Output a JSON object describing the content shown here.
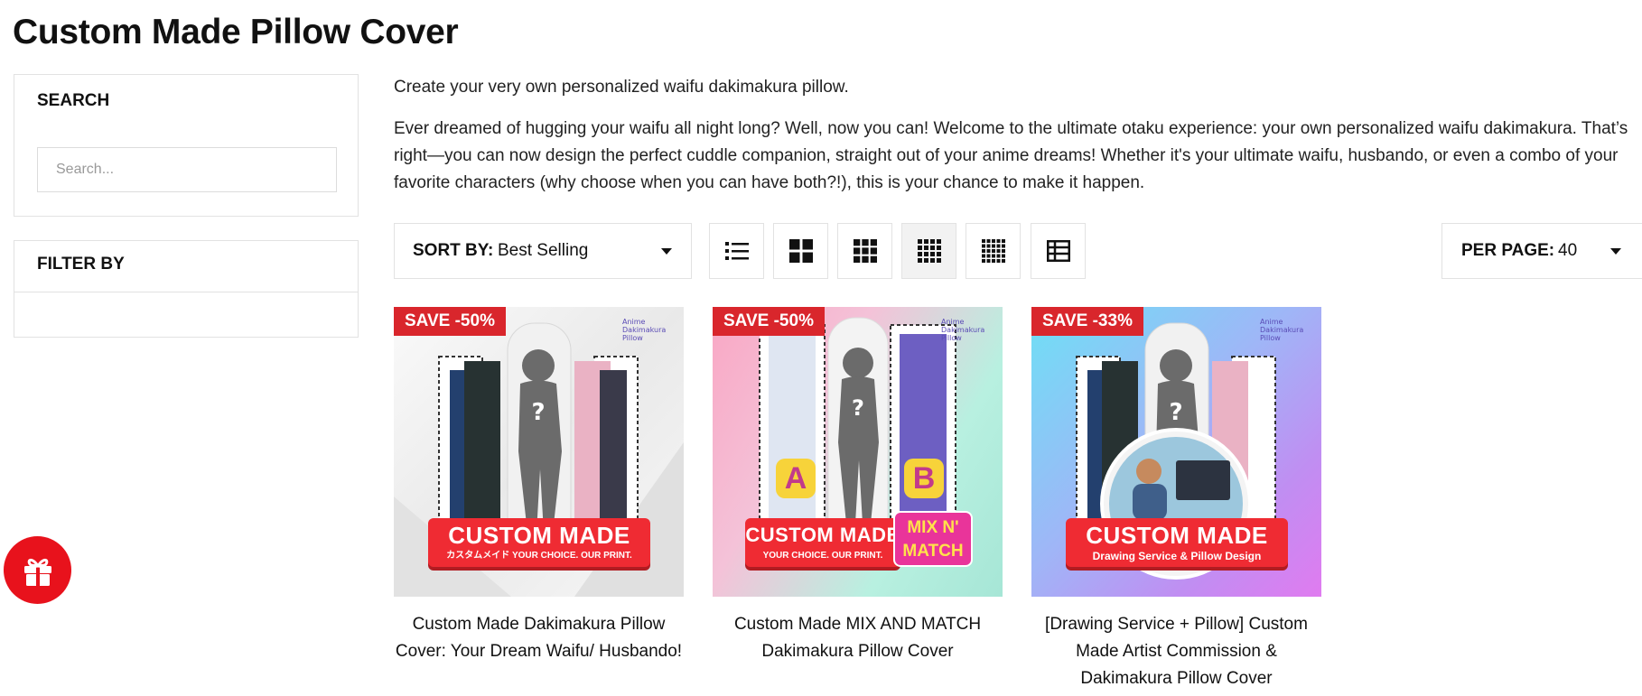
{
  "page": {
    "title": "Custom Made Pillow Cover"
  },
  "sidebar": {
    "search": {
      "heading": "SEARCH",
      "placeholder": "Search..."
    },
    "filter": {
      "heading": "FILTER BY"
    }
  },
  "description": {
    "line1": "Create your very own personalized waifu dakimakura pillow.",
    "paragraph": "Ever dreamed of hugging your waifu all night long? Well, now you can! Welcome to the ultimate otaku experience: your own personalized waifu dakimakura. That’s right—you can now design the perfect cuddle companion, straight out of your anime dreams! Whether it's your ultimate waifu, husbando, or even a combo of your favorite characters (why choose when you can have both?!), this is your chance to make it happen."
  },
  "toolbar": {
    "sort_label": "SORT BY:",
    "sort_value": "Best Selling",
    "per_page_label": "PER PAGE:",
    "per_page_value": "40",
    "views": [
      {
        "icon": "list-view-icon",
        "active": false
      },
      {
        "icon": "grid-2-icon",
        "active": false
      },
      {
        "icon": "grid-3-icon",
        "active": false
      },
      {
        "icon": "grid-4-icon",
        "active": true
      },
      {
        "icon": "grid-5-icon",
        "active": false
      },
      {
        "icon": "table-view-icon",
        "active": false
      }
    ]
  },
  "products": [
    {
      "badge": "SAVE -50%",
      "title": "Custom Made Dakimakura Pillow Cover: Your Dream Waifu/ Husbando!",
      "banner_main": "CUSTOM MADE",
      "banner_sub": "カスタムメイド YOUR CHOICE. OUR PRINT.",
      "logo": "Anime Dakimakura Pillow"
    },
    {
      "badge": "SAVE -50%",
      "title": "Custom Made MIX AND MATCH Dakimakura Pillow Cover",
      "banner_main": "CUSTOM MADE",
      "banner_sub": "YOUR CHOICE. OUR PRINT.",
      "banner_extra": "MIX N' MATCH",
      "label_a": "A",
      "label_b": "B",
      "logo": "Anime Dakimakura Pillow"
    },
    {
      "badge": "SAVE -33%",
      "title": "[Drawing Service + Pillow] Custom Made Artist Commission & Dakimakura Pillow Cover",
      "banner_main": "CUSTOM MADE",
      "banner_sub": "Drawing Service & Pillow Design",
      "logo": "Anime Dakimakura Pillow"
    }
  ],
  "colors": {
    "accent": "#d9262c",
    "gift": "#e8121c",
    "border": "#e2e2e2"
  },
  "icons": {
    "gift": "gift-icon"
  }
}
